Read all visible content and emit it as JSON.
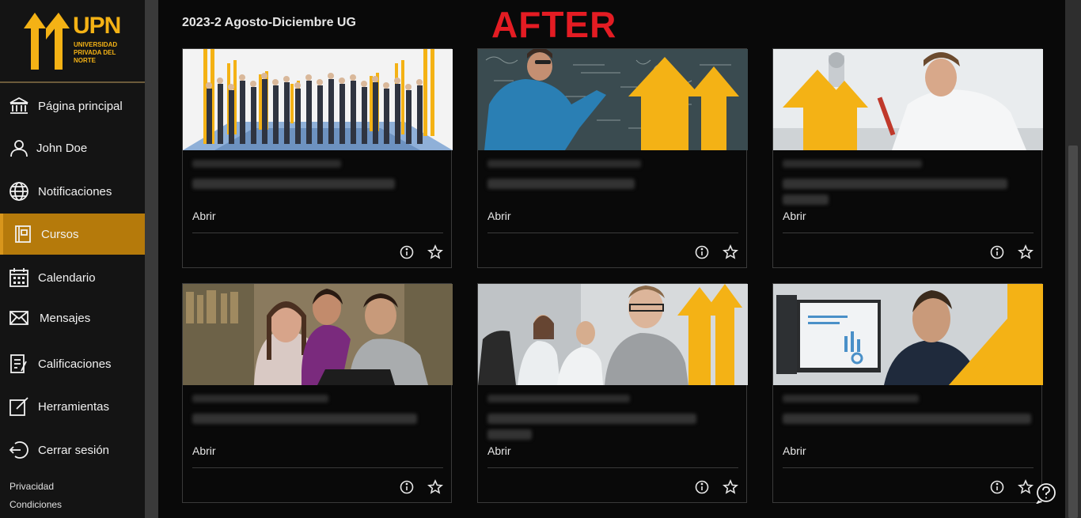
{
  "brand": {
    "logo_text": "UPN",
    "logo_subtitle": "UNIVERSIDAD PRIVADA DEL NORTE",
    "accent": "#f4b215",
    "active_bg": "#b57a0b"
  },
  "sidebar": {
    "items": [
      {
        "label": "Página principal",
        "icon": "institution-icon",
        "active": false
      },
      {
        "label": "John Doe",
        "icon": "user-icon",
        "active": false
      },
      {
        "label": "Notificaciones",
        "icon": "globe-icon",
        "active": false
      },
      {
        "label": "Cursos",
        "icon": "courses-icon",
        "active": true
      },
      {
        "label": "Calendario",
        "icon": "calendar-icon",
        "active": false
      },
      {
        "label": "Mensajes",
        "icon": "envelope-icon",
        "active": false
      },
      {
        "label": "Calificaciones",
        "icon": "grades-icon",
        "active": false
      },
      {
        "label": "Herramientas",
        "icon": "edit-icon",
        "active": false
      },
      {
        "label": "Cerrar sesión",
        "icon": "logout-icon",
        "active": false
      }
    ],
    "footer": {
      "privacy": "Privacidad",
      "terms": "Condiciones"
    }
  },
  "header": {
    "term": "2023-2 Agosto-Diciembre UG",
    "overlay_label": "AFTER",
    "overlay_color": "#e41c23"
  },
  "courses": [
    {
      "open_label": "Abrir",
      "image": "group-of-people-photo"
    },
    {
      "open_label": "Abrir",
      "image": "chalkboard-math-photo"
    },
    {
      "open_label": "Abrir",
      "image": "electronics-lab-photo"
    },
    {
      "open_label": "Abrir",
      "image": "students-laptop-photo"
    },
    {
      "open_label": "Abrir",
      "image": "business-meeting-photo"
    },
    {
      "open_label": "Abrir",
      "image": "data-analysis-photo"
    }
  ]
}
